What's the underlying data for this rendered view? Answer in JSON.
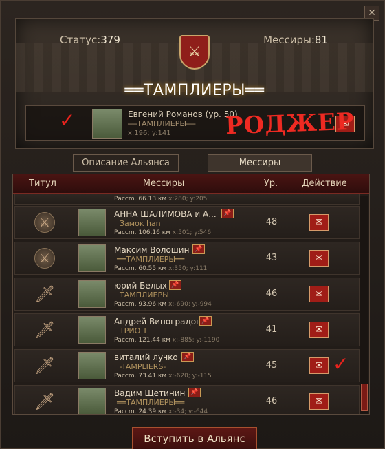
{
  "header": {
    "status_label": "Статус:",
    "status_value": "379",
    "mess_label": "Мессиры:",
    "mess_value": "81",
    "alliance_name": "══ТАМПЛИЕРЫ══"
  },
  "leader": {
    "name": "Евгений Романов (ур. 50)",
    "tag": "══ТАМПЛИЕРЫ══",
    "coords": "x:196; y:141"
  },
  "annotations": {
    "check_mark": "✓",
    "scrawl": "РОДЖЕР"
  },
  "tabs": {
    "description": "Описание Альянса",
    "messires": "Мессиры"
  },
  "table": {
    "headers": {
      "title": "Титул",
      "messires": "Мессиры",
      "level": "Ур.",
      "action": "Действие"
    },
    "partial_row": {
      "dist_label": "Рассm.",
      "dist": "66.13 км",
      "coords": "x:280; y:205"
    },
    "rows": [
      {
        "name": "АННА ШАЛИМОВА и А...",
        "tag": "Замок han",
        "dist_label": "Рассm.",
        "dist": "106.16 км",
        "coords": "x:501; y:546",
        "level": "48",
        "icon": "medal-axes-icon"
      },
      {
        "name": "Максим Волошин",
        "tag": "══ТАМПЛИЕРЫ══",
        "dist_label": "Рассm.",
        "dist": "60.55 км",
        "coords": "x:350; y:111",
        "level": "43",
        "icon": "medal-axes-icon"
      },
      {
        "name": "юрий Белых",
        "tag": "ТАМПЛИЕРЫ",
        "dist_label": "Рассm.",
        "dist": "93.96 км",
        "coords": "x:-690; y:-994",
        "level": "46",
        "icon": "sword-icon"
      },
      {
        "name": "Андрей Виноградов",
        "tag": "ТРИО Т",
        "dist_label": "Рассm.",
        "dist": "121.44 км",
        "coords": "x:-885; y:-1190",
        "level": "41",
        "icon": "sword-icon"
      },
      {
        "name": "виталий лучко",
        "tag": "-TAMPLIERS-",
        "dist_label": "Рассm.",
        "dist": "73.41 км",
        "coords": "x:-620; y:-115",
        "level": "45",
        "icon": "sword-icon"
      },
      {
        "name": "Вадим Щетинин",
        "tag": "══ТАМПЛИЕРЫ══",
        "dist_label": "Рассm.",
        "dist": "24.39 км",
        "coords": "x:-34; y:-644",
        "level": "46",
        "icon": "sword-icon"
      }
    ]
  },
  "join_button": "Вступить в Альянс",
  "colors": {
    "accent_red": "#a01d17",
    "gold": "#c9a66b",
    "annotation_red": "#ee2a22"
  }
}
